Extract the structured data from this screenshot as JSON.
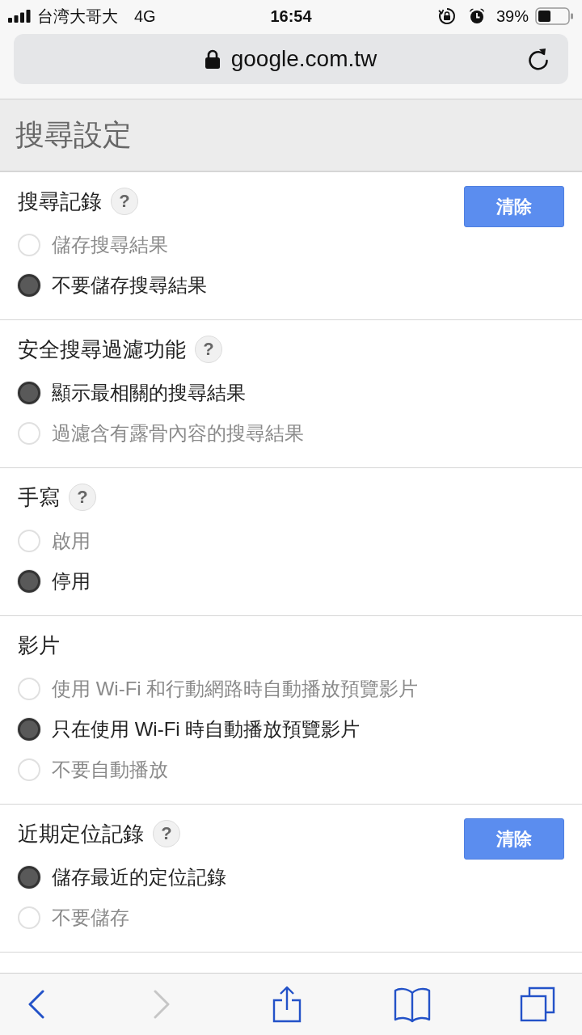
{
  "status_bar": {
    "carrier": "台湾大哥大",
    "network": "4G",
    "time": "16:54",
    "battery": "39%"
  },
  "address_bar": {
    "url": "google.com.tw"
  },
  "page_title": "搜尋設定",
  "sections": [
    {
      "title": "搜尋記錄",
      "help": "?",
      "button": "清除",
      "options": [
        {
          "label": "儲存搜尋結果",
          "selected": false
        },
        {
          "label": "不要儲存搜尋結果",
          "selected": true
        }
      ]
    },
    {
      "title": "安全搜尋過濾功能",
      "help": "?",
      "options": [
        {
          "label": "顯示最相關的搜尋結果",
          "selected": true
        },
        {
          "label": "過濾含有露骨內容的搜尋結果",
          "selected": false
        }
      ]
    },
    {
      "title": "手寫",
      "help": "?",
      "options": [
        {
          "label": "啟用",
          "selected": false
        },
        {
          "label": "停用",
          "selected": true
        }
      ]
    },
    {
      "title": "影片",
      "options": [
        {
          "label": "使用 Wi-Fi 和行動網路時自動播放預覽影片",
          "selected": false
        },
        {
          "label": "只在使用 Wi-Fi 時自動播放預覽影片",
          "selected": true
        },
        {
          "label": "不要自動播放",
          "selected": false
        }
      ]
    },
    {
      "title": "近期定位記錄",
      "help": "?",
      "button": "清除",
      "options": [
        {
          "label": "儲存最近的定位記錄",
          "selected": true
        },
        {
          "label": "不要儲存",
          "selected": false
        }
      ]
    }
  ],
  "toolbar": [
    {
      "kind": "back",
      "disabled": false
    },
    {
      "kind": "forward",
      "disabled": true
    },
    {
      "kind": "share",
      "disabled": false
    },
    {
      "kind": "bookmarks",
      "disabled": false
    },
    {
      "kind": "tabs",
      "disabled": false
    }
  ]
}
